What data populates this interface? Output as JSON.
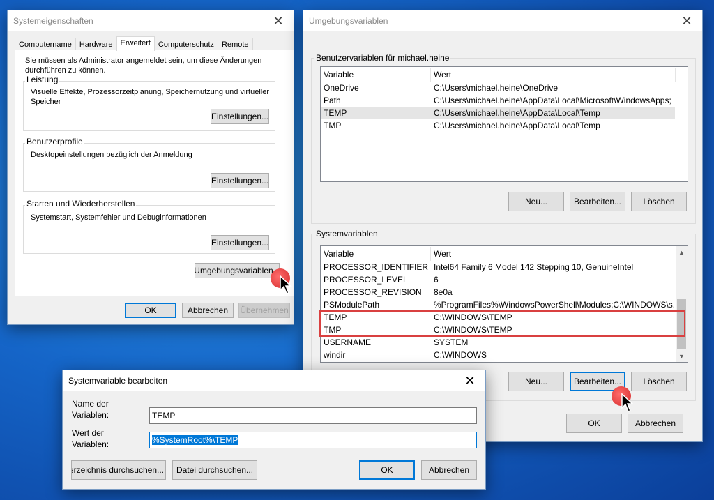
{
  "sys_props": {
    "title": "Systemeigenschaften",
    "tabs": [
      "Computername",
      "Hardware",
      "Erweitert",
      "Computerschutz",
      "Remote"
    ],
    "admin_note": "Sie müssen als Administrator angemeldet sein, um diese Änderungen durchführen zu können.",
    "performance": {
      "label": "Leistung",
      "desc": "Visuelle Effekte, Prozessorzeitplanung, Speichernutzung und virtueller Speicher",
      "button": "Einstellungen..."
    },
    "profiles": {
      "label": "Benutzerprofile",
      "desc": "Desktopeinstellungen bezüglich der Anmeldung",
      "button": "Einstellungen..."
    },
    "startup": {
      "label": "Starten und Wiederherstellen",
      "desc": "Systemstart, Systemfehler und Debuginformationen",
      "button": "Einstellungen..."
    },
    "env_button": "Umgebungsvariablen...",
    "ok": "OK",
    "cancel": "Abbrechen",
    "apply": "Übernehmen"
  },
  "env_vars": {
    "title": "Umgebungsvariablen",
    "user_group": "Benutzervariablen für michael.heine",
    "col_variable": "Variable",
    "col_value": "Wert",
    "user_rows": [
      {
        "name": "OneDrive",
        "value": "C:\\Users\\michael.heine\\OneDrive"
      },
      {
        "name": "Path",
        "value": "C:\\Users\\michael.heine\\AppData\\Local\\Microsoft\\WindowsApps;"
      },
      {
        "name": "TEMP",
        "value": "C:\\Users\\michael.heine\\AppData\\Local\\Temp"
      },
      {
        "name": "TMP",
        "value": "C:\\Users\\michael.heine\\AppData\\Local\\Temp"
      }
    ],
    "user_buttons": {
      "new": "Neu...",
      "edit": "Bearbeiten...",
      "delete": "Löschen"
    },
    "sys_group": "Systemvariablen",
    "sys_rows": [
      {
        "name": "PROCESSOR_IDENTIFIER",
        "value": "Intel64 Family 6 Model 142 Stepping 10, GenuineIntel"
      },
      {
        "name": "PROCESSOR_LEVEL",
        "value": "6"
      },
      {
        "name": "PROCESSOR_REVISION",
        "value": "8e0a"
      },
      {
        "name": "PSModulePath",
        "value": "%ProgramFiles%\\WindowsPowerShell\\Modules;C:\\WINDOWS\\s..."
      },
      {
        "name": "TEMP",
        "value": "C:\\WINDOWS\\TEMP"
      },
      {
        "name": "TMP",
        "value": "C:\\WINDOWS\\TEMP"
      },
      {
        "name": "USERNAME",
        "value": "SYSTEM"
      },
      {
        "name": "windir",
        "value": "C:\\WINDOWS"
      }
    ],
    "sys_buttons": {
      "new": "Neu...",
      "edit": "Bearbeiten...",
      "delete": "Löschen"
    },
    "ok": "OK",
    "cancel": "Abbrechen"
  },
  "edit_dialog": {
    "title": "Systemvariable bearbeiten",
    "name_label": "Name der Variablen:",
    "name_value": "TEMP",
    "value_label": "Wert der Variablen:",
    "value_value": "%SystemRoot%\\TEMP",
    "browse_dir": "Verzeichnis durchsuchen...",
    "browse_file": "Datei durchsuchen...",
    "ok": "OK",
    "cancel": "Abbrechen"
  },
  "colors": {
    "highlight": "#d94040",
    "accent": "#0078d7",
    "cursor_dot": "#e03a3a"
  },
  "icons": {
    "close": "close-icon",
    "cursor": "mouse-pointer-icon"
  }
}
